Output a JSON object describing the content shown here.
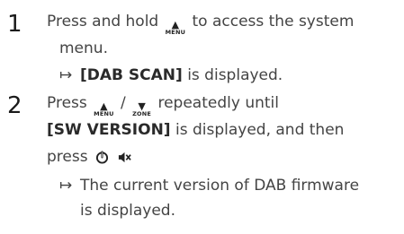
{
  "steps": [
    {
      "number": "1",
      "lines": {
        "l1_pre": "Press and hold",
        "l1_key": "MENU",
        "l1_post": "to access the system",
        "l2": "menu."
      },
      "result": {
        "bold": "[DAB SCAN]",
        "rest": "is displayed."
      }
    },
    {
      "number": "2",
      "lines": {
        "l1_pre": "Press",
        "l1_key1": "MENU",
        "l1_sep": "/",
        "l1_key2": "ZONE",
        "l1_post": "repeatedly until",
        "l2_bold": "[SW VERSION]",
        "l2_rest": "is displayed, and then",
        "l3": "press"
      },
      "result": {
        "line1": "The current version of DAB firmware",
        "line2": "is displayed."
      }
    }
  ],
  "icons": {
    "result_arrow": "↦",
    "up_triangle": "▲",
    "down_triangle": "▼",
    "power": "power-icon",
    "mute": "mute-icon"
  }
}
